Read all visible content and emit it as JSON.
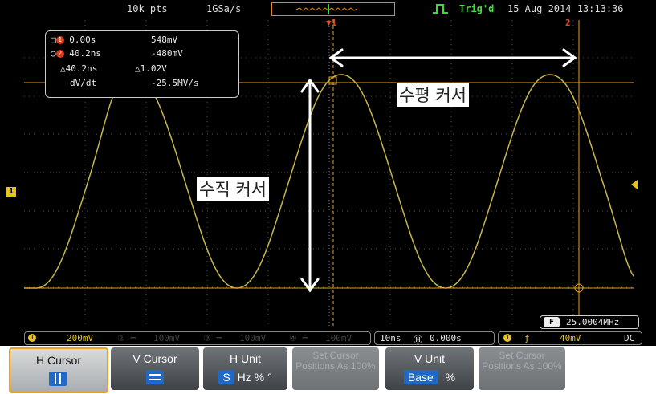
{
  "top_bar": {
    "points": "10k pts",
    "sample_rate": "1GSa/s",
    "trigger_status": "Trig'd",
    "datetime": "15 Aug 2014 13:13:36"
  },
  "cursor_readout": {
    "c1_time": "0.00s",
    "c1_volt": "548mV",
    "c2_time": "40.2ns",
    "c2_volt": "-480mV",
    "delta_time": "△40.2ns",
    "delta_volt": "△1.02V",
    "dvdt_label": "dV/dt",
    "dvdt_value": "-25.5MV/s"
  },
  "markers": {
    "channel1": "1",
    "cursor1": "1",
    "cursor2": "2"
  },
  "annotations": {
    "horizontal_cursor": "수평 커서",
    "vertical_cursor": "수직 커서"
  },
  "frequency": {
    "badge": "F",
    "value": "25.0004MHz"
  },
  "status_bar": {
    "ch1_scale": "200mV",
    "ch2_scale": "100mV",
    "ch3_scale": "100mV",
    "ch4_scale": "100mV",
    "timebase": "10ns",
    "position": "0.000s",
    "trigger_level": "40mV",
    "coupling": "DC"
  },
  "softkeys": {
    "h_cursor": "H Cursor",
    "v_cursor": "V Cursor",
    "h_unit": "H Unit",
    "h_unit_options": {
      "s": "S",
      "hz": "Hz",
      "pct": "%",
      "deg": "°"
    },
    "set_cursor_a": "Set Cursor Positions As 100%",
    "v_unit": "V Unit",
    "v_unit_options": {
      "base": "Base",
      "pct": "%"
    },
    "set_cursor_b": "Set Cursor Positions As 100%"
  },
  "colors": {
    "trace": "#c8b64a",
    "cursor": "#e8a020",
    "grid": "#555555",
    "highlight": "#1e68c8"
  }
}
